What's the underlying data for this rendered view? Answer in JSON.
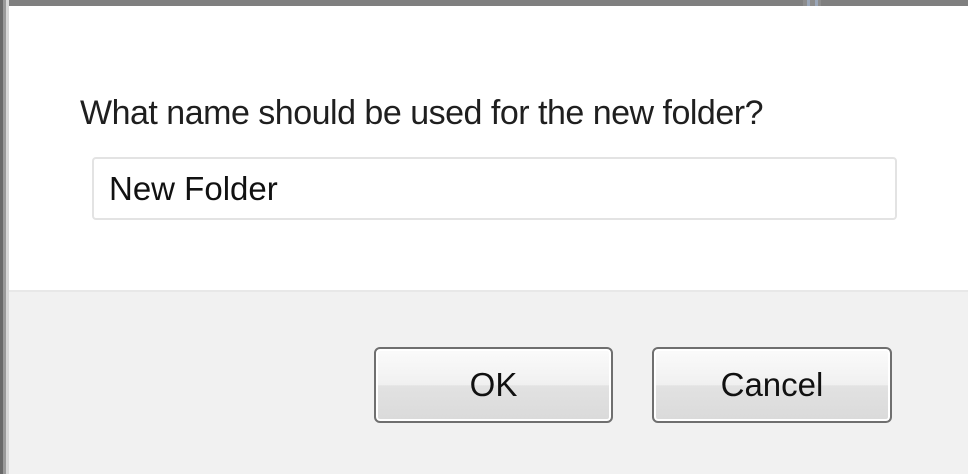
{
  "dialog": {
    "prompt": "What name should be used for the new folder?",
    "folder_name_value": "New Folder",
    "ok_label": "OK",
    "cancel_label": "Cancel"
  },
  "colors": {
    "footer_background": "#f1f1f1",
    "input_border": "#e3e3e3",
    "button_border": "#6f6f6f"
  }
}
